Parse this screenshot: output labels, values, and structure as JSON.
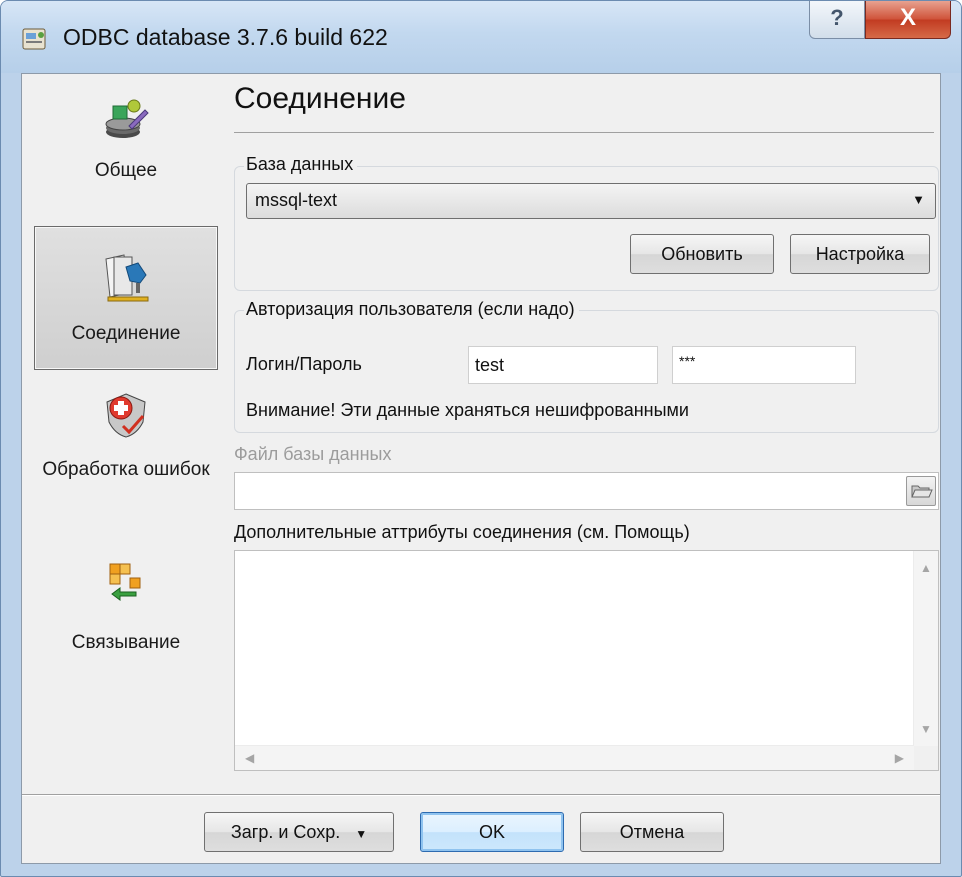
{
  "window": {
    "title": "ODBC database 3.7.6 build 622",
    "help_glyph": "?",
    "close_glyph": "X"
  },
  "nav": {
    "items": [
      {
        "label": "Общее",
        "icon": "discs-gear-icon"
      },
      {
        "label": "Соединение",
        "icon": "cards-connector-icon",
        "selected": true
      },
      {
        "label": "Обработка ошибок",
        "icon": "shield-cross-icon"
      },
      {
        "label": "Связывание",
        "icon": "grid-arrow-link-icon"
      }
    ]
  },
  "main": {
    "title": "Соединение",
    "database_group": {
      "label": "База данных",
      "selected": "mssql-text",
      "refresh_button": "Обновить",
      "settings_button": "Настройка"
    },
    "auth_group": {
      "label": "Авторизация пользователя (если надо)",
      "login_label": "Логин/Пароль",
      "login_value": "test",
      "password_value": "***",
      "warning": "Внимание! Эти данные храняться нешифрованными"
    },
    "file_label": "Файл базы данных",
    "file_value": "",
    "attrs_label": "Дополнительные аттрибуты соединения (см. Помощь)",
    "attrs_value": ""
  },
  "footer": {
    "load_save_button": "Загр. и Сохр.",
    "ok_button": "OK",
    "cancel_button": "Отмена"
  },
  "colors": {
    "titlebar": "#c2d8ef",
    "client_bg": "#f0f0f0",
    "close_button": "#c94a2f",
    "default_button_border": "#2d6bb0"
  }
}
